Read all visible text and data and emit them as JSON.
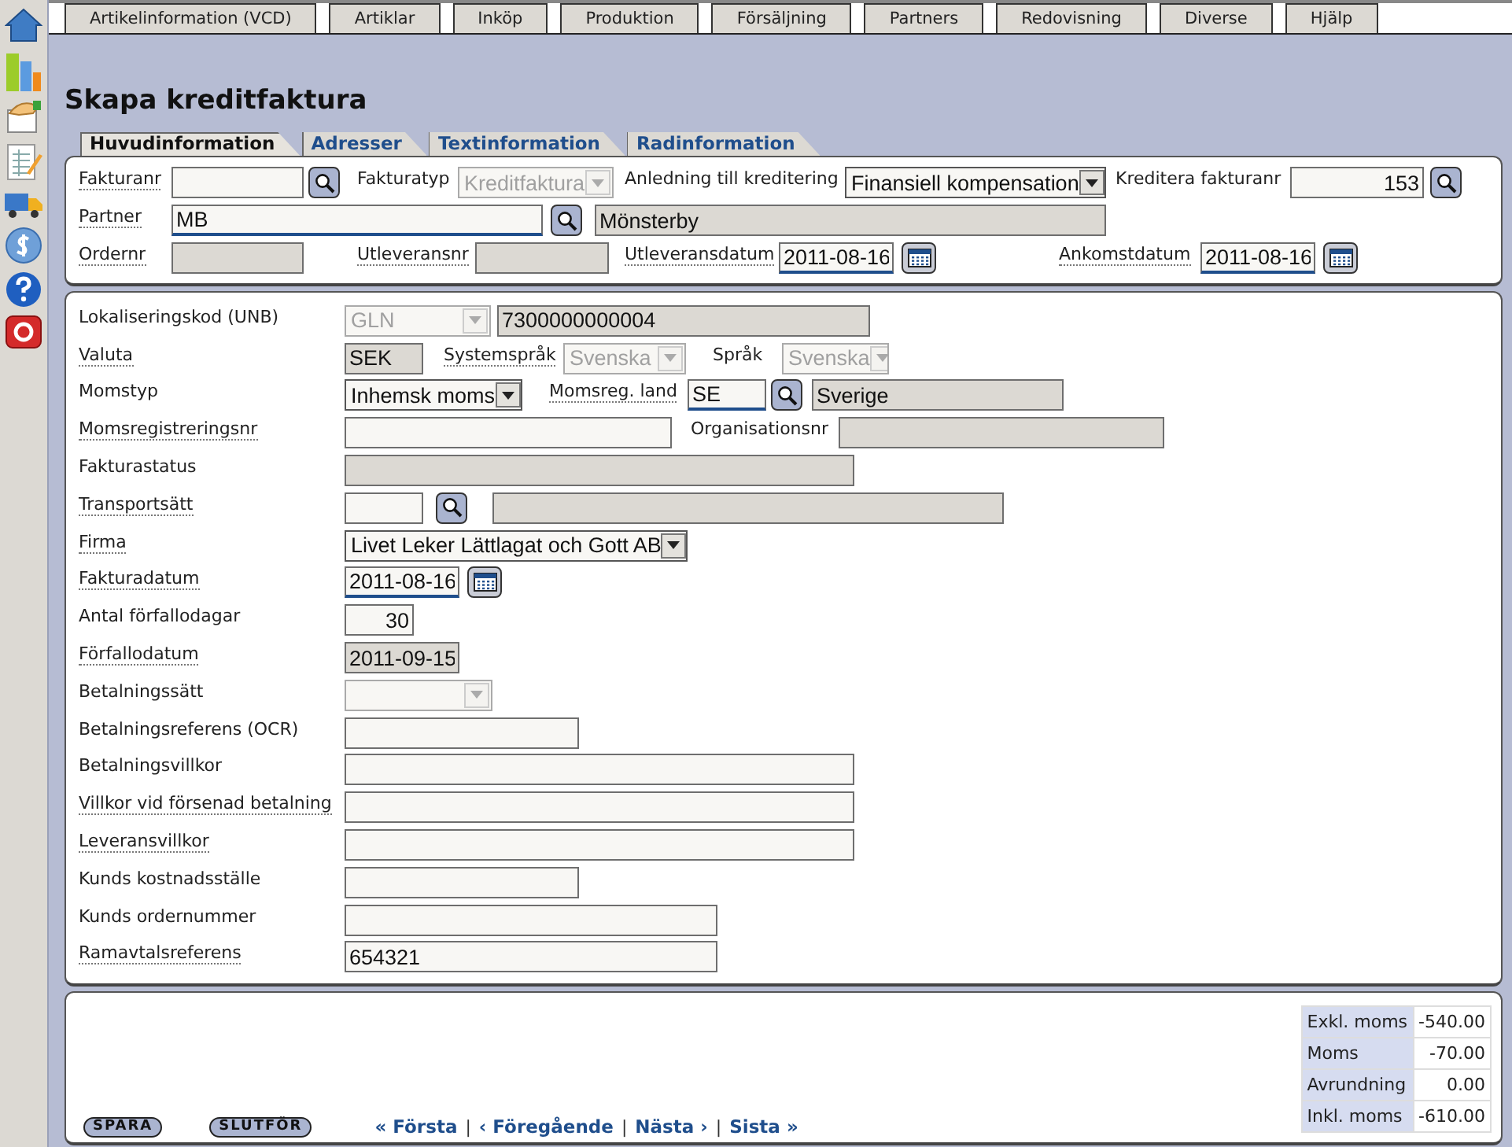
{
  "menu_tabs": [
    {
      "label": "Artikelinformation (VCD)"
    },
    {
      "label": "Artiklar"
    },
    {
      "label": "Inköp"
    },
    {
      "label": "Produktion"
    },
    {
      "label": "Försäljning"
    },
    {
      "label": "Partners"
    },
    {
      "label": "Redovisning"
    },
    {
      "label": "Diverse"
    },
    {
      "label": "Hjälp"
    }
  ],
  "title": "Skapa kreditfaktura",
  "tabs": [
    {
      "label": "Huvudinformation",
      "selected": true
    },
    {
      "label": "Adresser",
      "selected": false
    },
    {
      "label": "Textinformation",
      "selected": false
    },
    {
      "label": "Radinformation",
      "selected": false
    }
  ],
  "header": {
    "rows": [
      {
        "fields": [
          {
            "label": "Fakturanr",
            "hint": true,
            "controls": [
              {
                "kind": "input"
              },
              {
                "kind": "lookup"
              }
            ]
          },
          {
            "label": "Fakturatyp",
            "hint": false,
            "controls": [
              {
                "kind": "select",
                "value": "Kreditfaktura",
                "disabled": true
              }
            ]
          },
          {
            "label": "Anledning till kreditering",
            "hint": false,
            "controls": [
              {
                "kind": "select",
                "value": "Finansiell kompensation",
                "disabled": false
              }
            ]
          },
          {
            "label": "Kreditera fakturanr",
            "hint": false,
            "controls": [
              {
                "kind": "number",
                "value": "153"
              },
              {
                "kind": "lookup"
              }
            ]
          }
        ]
      },
      {
        "fields": [
          {
            "label": "Partner",
            "hint": true,
            "controls": [
              {
                "kind": "input",
                "value": "MB",
                "required": true
              },
              {
                "kind": "lookup"
              },
              {
                "kind": "readonly",
                "value": "Mönsterby"
              }
            ]
          }
        ]
      },
      {
        "fields": [
          {
            "label": "Ordernr",
            "hint": true,
            "controls": [
              {
                "kind": "readonly"
              }
            ]
          },
          {
            "label": "Utleveransnr",
            "hint": true,
            "controls": [
              {
                "kind": "readonly"
              }
            ]
          },
          {
            "label": "Utleveransdatum",
            "hint": true,
            "controls": [
              {
                "kind": "input",
                "value": "2011-08-16",
                "required": true
              },
              {
                "kind": "calendar"
              }
            ]
          },
          {
            "label": "Ankomstdatum",
            "hint": true,
            "controls": [
              {
                "kind": "input",
                "value": "2011-08-16",
                "required": true
              },
              {
                "kind": "calendar"
              }
            ]
          }
        ]
      }
    ]
  },
  "details": {
    "rows": [
      {
        "fields": [
          {
            "label": "Lokaliseringskod (UNB)",
            "hint": false,
            "controls": [
              {
                "kind": "select",
                "value": "GLN",
                "disabled": true
              },
              {
                "kind": "readonly",
                "value": "7300000000004"
              }
            ]
          }
        ]
      },
      {
        "fields": [
          {
            "label": "Valuta",
            "hint": true,
            "controls": [
              {
                "kind": "readonly",
                "value": "SEK"
              }
            ]
          },
          {
            "label": "Systemspråk",
            "hint": true,
            "controls": [
              {
                "kind": "select",
                "value": "Svenska",
                "disabled": true
              }
            ]
          },
          {
            "label": "Språk",
            "hint": false,
            "controls": [
              {
                "kind": "select",
                "value": "Svenska",
                "disabled": true
              }
            ]
          }
        ]
      },
      {
        "fields": [
          {
            "label": "Momstyp",
            "hint": false,
            "controls": [
              {
                "kind": "select",
                "value": "Inhemsk moms",
                "disabled": false
              }
            ]
          },
          {
            "label": "Momsreg. land",
            "hint": true,
            "controls": [
              {
                "kind": "input",
                "value": "SE",
                "required": true
              },
              {
                "kind": "lookup"
              },
              {
                "kind": "readonly",
                "value": "Sverige"
              }
            ]
          }
        ]
      },
      {
        "fields": [
          {
            "label": "Momsregistreringsnr",
            "hint": true,
            "controls": [
              {
                "kind": "input"
              }
            ]
          },
          {
            "label": "Organisationsnr",
            "hint": false,
            "controls": [
              {
                "kind": "readonly"
              }
            ]
          }
        ]
      },
      {
        "fields": [
          {
            "label": "Fakturastatus",
            "hint": false,
            "controls": [
              {
                "kind": "readonly"
              }
            ]
          }
        ]
      },
      {
        "fields": [
          {
            "label": "Transportsätt",
            "hint": true,
            "controls": [
              {
                "kind": "input"
              },
              {
                "kind": "lookup"
              },
              {
                "kind": "readonly"
              }
            ]
          }
        ]
      },
      {
        "fields": [
          {
            "label": "Firma",
            "hint": true,
            "controls": [
              {
                "kind": "select",
                "value": "Livet Leker Lättlagat och Gott AB",
                "disabled": false
              }
            ]
          }
        ]
      },
      {
        "fields": [
          {
            "label": "Fakturadatum",
            "hint": true,
            "controls": [
              {
                "kind": "input",
                "value": "2011-08-16",
                "required": true
              },
              {
                "kind": "calendar"
              }
            ]
          }
        ]
      },
      {
        "fields": [
          {
            "label": "Antal förfallodagar",
            "hint": false,
            "controls": [
              {
                "kind": "number",
                "value": "30"
              }
            ]
          }
        ]
      },
      {
        "fields": [
          {
            "label": "Förfallodatum",
            "hint": true,
            "controls": [
              {
                "kind": "readonly",
                "value": "2011-09-15"
              }
            ]
          }
        ]
      },
      {
        "fields": [
          {
            "label": "Betalningssätt",
            "hint": false,
            "controls": [
              {
                "kind": "select",
                "disabled": true
              }
            ]
          }
        ]
      },
      {
        "fields": [
          {
            "label": "Betalningsreferens (OCR)",
            "hint": false,
            "controls": [
              {
                "kind": "input"
              }
            ]
          }
        ]
      },
      {
        "fields": [
          {
            "label": "Betalningsvillkor",
            "hint": false,
            "controls": [
              {
                "kind": "input"
              }
            ]
          }
        ]
      },
      {
        "fields": [
          {
            "label": "Villkor vid försenad betalning",
            "hint": true,
            "controls": [
              {
                "kind": "input"
              }
            ]
          }
        ]
      },
      {
        "fields": [
          {
            "label": "Leveransvillkor",
            "hint": true,
            "controls": [
              {
                "kind": "input"
              }
            ]
          }
        ]
      },
      {
        "fields": [
          {
            "label": "Kunds kostnadsställe",
            "hint": false,
            "controls": [
              {
                "kind": "input"
              }
            ]
          }
        ]
      },
      {
        "fields": [
          {
            "label": "Kunds ordernummer",
            "hint": false,
            "controls": [
              {
                "kind": "input"
              }
            ]
          }
        ]
      },
      {
        "fields": [
          {
            "label": "Ramavtalsreferens",
            "hint": true,
            "controls": [
              {
                "kind": "input",
                "value": "654321"
              }
            ]
          }
        ]
      }
    ]
  },
  "footer": {
    "buttons": [
      "SPARA",
      "SLUTFÖR"
    ],
    "pager": {
      "separator": "|",
      "links": [
        "« Första",
        "‹ Föregående",
        "Nästa ›",
        "Sista »"
      ]
    },
    "totals": [
      {
        "label": "Exkl. moms",
        "value": "-540.00"
      },
      {
        "label": "Moms",
        "value": "-70.00"
      },
      {
        "label": "Avrundning",
        "value": "0.00"
      },
      {
        "label": "Inkl. moms",
        "value": "-610.00"
      }
    ]
  }
}
